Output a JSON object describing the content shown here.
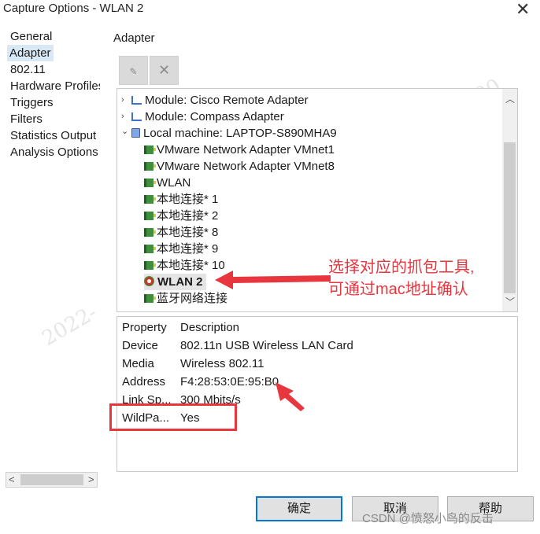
{
  "window": {
    "title": "Capture Options - WLAN 2",
    "close_glyph": "✕"
  },
  "nav": {
    "items": [
      "General",
      "Adapter",
      "802.11",
      "Hardware Profiles",
      "Triggers",
      "Filters",
      "Statistics Output",
      "Analysis Options"
    ],
    "selected": "Adapter"
  },
  "section_title": "Adapter",
  "toolbar": {
    "edit_icon": "pencil-icon",
    "delete_icon": "x-icon"
  },
  "tree": {
    "items": [
      {
        "label": "Module: Cisco Remote Adapter",
        "toggle": "›",
        "icon": "module-icon"
      },
      {
        "label": "Module: Compass Adapter",
        "toggle": "›",
        "icon": "module-icon"
      },
      {
        "label": "Local machine: LAPTOP-S890MHA9",
        "toggle": "⌄",
        "icon": "computer-icon"
      },
      {
        "label": "VMware Network Adapter VMnet1",
        "icon": "network-adapter-icon"
      },
      {
        "label": "VMware Network Adapter VMnet8",
        "icon": "network-adapter-icon"
      },
      {
        "label": "WLAN",
        "icon": "network-adapter-icon"
      },
      {
        "label": "本地连接* 1",
        "icon": "network-adapter-icon"
      },
      {
        "label": "本地连接* 2",
        "icon": "network-adapter-icon"
      },
      {
        "label": "本地连接* 8",
        "icon": "network-adapter-icon"
      },
      {
        "label": "本地连接* 9",
        "icon": "network-adapter-icon"
      },
      {
        "label": "本地连接* 10",
        "icon": "network-adapter-icon"
      },
      {
        "label": "WLAN 2",
        "icon": "wireless-adapter-icon",
        "selected": true
      },
      {
        "label": "蓝牙网络连接",
        "icon": "network-adapter-icon"
      }
    ]
  },
  "properties": {
    "headers": [
      "Property",
      "Description"
    ],
    "rows": [
      [
        "Device",
        "802.11n USB Wireless LAN Card"
      ],
      [
        "Media",
        "Wireless 802.11"
      ],
      [
        "Address",
        "F4:28:53:0E:95:B0"
      ],
      [
        "Link Sp...",
        "300 Mbits/s"
      ],
      [
        "WildPa...",
        "Yes"
      ]
    ]
  },
  "buttons": {
    "ok": "确定",
    "cancel": "取消",
    "help": "帮助"
  },
  "annotation": {
    "line1": "选择对应的抓包工具,",
    "line2": "可通过mac地址确认",
    "color": "#e8363e"
  },
  "background_watermark": "2022-…  16:52:1…  0C-DD-24-90",
  "watermark": "CSDN @愤怒小鸟的反击"
}
